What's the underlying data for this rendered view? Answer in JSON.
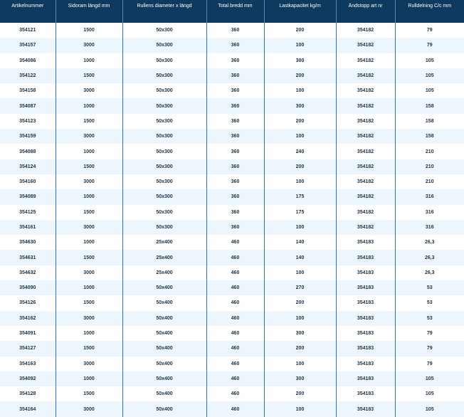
{
  "table": {
    "headers": [
      "Artikelnummer",
      "Sidoram längd mm",
      "Rullens diameter x längd",
      "Total bredd mm",
      "Lastkapacitet kg/m",
      "Ändstopp art nr",
      "Rulldelning C/c mm"
    ],
    "rows": [
      [
        "354121",
        "1500",
        "50x300",
        "360",
        "200",
        "354182",
        "79"
      ],
      [
        "354157",
        "3000",
        "50x300",
        "360",
        "100",
        "354182",
        "79"
      ],
      [
        "354086",
        "1000",
        "50x300",
        "360",
        "300",
        "354182",
        "105"
      ],
      [
        "354122",
        "1500",
        "50x300",
        "360",
        "200",
        "354182",
        "105"
      ],
      [
        "354158",
        "3000",
        "50x300",
        "360",
        "100",
        "354182",
        "105"
      ],
      [
        "354087",
        "1000",
        "50x300",
        "360",
        "300",
        "354182",
        "158"
      ],
      [
        "354123",
        "1500",
        "50x300",
        "360",
        "200",
        "354182",
        "158"
      ],
      [
        "354159",
        "3000",
        "50x300",
        "360",
        "100",
        "354182",
        "158"
      ],
      [
        "354088",
        "1000",
        "50x300",
        "360",
        "240",
        "354182",
        "210"
      ],
      [
        "354124",
        "1500",
        "50x300",
        "360",
        "200",
        "354182",
        "210"
      ],
      [
        "354160",
        "3000",
        "50x300",
        "360",
        "100",
        "354182",
        "210"
      ],
      [
        "354089",
        "1000",
        "50x300",
        "360",
        "175",
        "354182",
        "316"
      ],
      [
        "354125",
        "1500",
        "50x300",
        "360",
        "175",
        "354182",
        "316"
      ],
      [
        "354161",
        "3000",
        "50x300",
        "360",
        "100",
        "354182",
        "316"
      ],
      [
        "354630",
        "1000",
        "25x400",
        "460",
        "140",
        "354183",
        "26,3"
      ],
      [
        "354631",
        "1500",
        "25x400",
        "460",
        "140",
        "354183",
        "26,3"
      ],
      [
        "354632",
        "3000",
        "25x400",
        "460",
        "100",
        "354183",
        "26,3"
      ],
      [
        "354090",
        "1000",
        "50x400",
        "460",
        "270",
        "354183",
        "53"
      ],
      [
        "354126",
        "1500",
        "50x400",
        "460",
        "200",
        "354183",
        "53"
      ],
      [
        "354162",
        "3000",
        "50x400",
        "460",
        "100",
        "354183",
        "53"
      ],
      [
        "354091",
        "1000",
        "50x400",
        "460",
        "300",
        "354183",
        "79"
      ],
      [
        "354127",
        "1500",
        "50x400",
        "460",
        "200",
        "354183",
        "79"
      ],
      [
        "354163",
        "3000",
        "50x400",
        "460",
        "100",
        "354183",
        "79"
      ],
      [
        "354092",
        "1000",
        "50x400",
        "460",
        "300",
        "354183",
        "105"
      ],
      [
        "354128",
        "1500",
        "50x400",
        "460",
        "200",
        "354183",
        "105"
      ],
      [
        "354164",
        "3000",
        "50x400",
        "460",
        "100",
        "354183",
        "105"
      ]
    ]
  },
  "colors": {
    "header_bg": "#0e3a5f",
    "header_text": "#ffffff",
    "row_alt_bg": "#eef6fd",
    "divider": "#2e73b8",
    "cell_text": "#1f3446"
  }
}
